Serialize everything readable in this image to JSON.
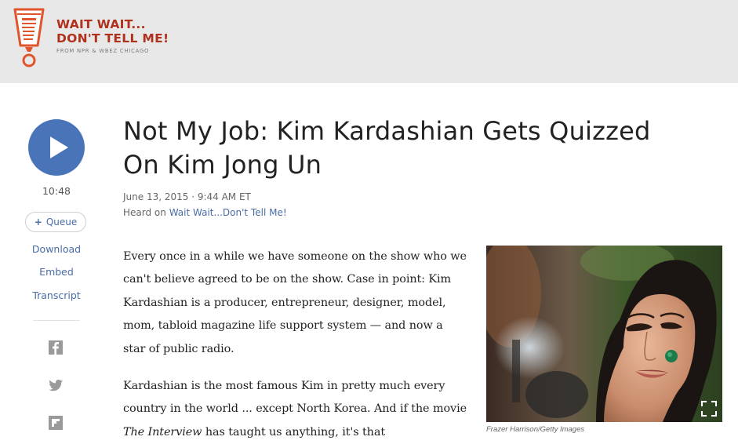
{
  "header": {
    "logo_line1": "WAIT WAIT...",
    "logo_line2": "DON'T TELL ME!",
    "logo_line3": "FROM NPR & WBEZ CHICAGO",
    "logo_icon": "cup-exclamation-icon",
    "background": "#e8e8e8",
    "brand_color": "#b0321d"
  },
  "player": {
    "play_icon": "play-icon",
    "duration": "10:48",
    "queue_label": "Queue",
    "accent": "#4a74b8"
  },
  "sidebar": {
    "download": "Download",
    "embed": "Embed",
    "transcript": "Transcript",
    "share_icons": [
      "facebook-icon",
      "twitter-icon",
      "flipboard-icon"
    ]
  },
  "article": {
    "title": "Not My Job: Kim Kardashian Gets Quizzed On Kim Jong Un",
    "date": "June 13, 2015 · 9:44 AM ET",
    "heard_prefix": "Heard on ",
    "heard_show": "Wait Wait...Don't Tell Me!",
    "para1": "Every once in a while we have someone on the show who we can't believe agreed to be on the show. Case in point: Kim Kardashian is a producer, entrepreneur, designer, model, mom, tabloid magazine life support system — and now a star of public radio.",
    "para2_a": "Kardashian is the most famous Kim in pretty much every country in the world ... except North Korea. And if the movie ",
    "para2_em": "The Interview",
    "para2_b": " has taught us anything, it's that",
    "image_caption": "Frazer Harrison/Getty Images",
    "enlarge_icon": "expand-icon"
  }
}
